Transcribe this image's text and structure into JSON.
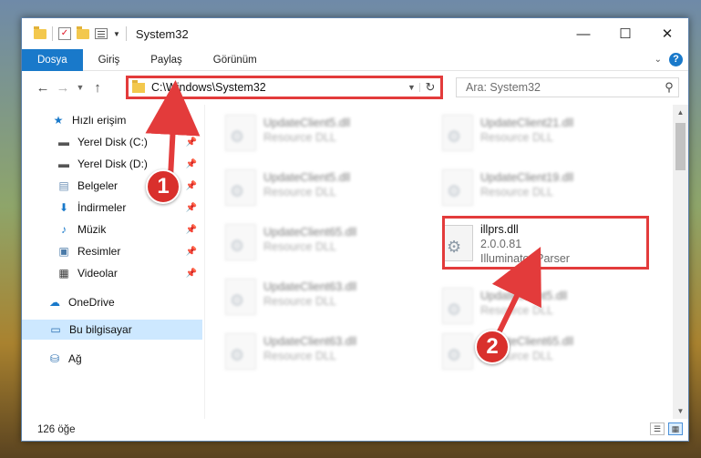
{
  "window": {
    "title": "System32",
    "controls": {
      "minimize": "—",
      "maximize": "☐",
      "close": "✕"
    }
  },
  "ribbon": {
    "tabs": [
      {
        "label": "Dosya",
        "active": true
      },
      {
        "label": "Giriş"
      },
      {
        "label": "Paylaş"
      },
      {
        "label": "Görünüm"
      }
    ],
    "expand_icon": "chevron-down-icon",
    "help_label": "?"
  },
  "address": {
    "path": "C:\\Windows\\System32",
    "search_placeholder": "Ara: System32"
  },
  "sidebar": {
    "items": [
      {
        "label": "Hızlı erişim",
        "icon": "star-icon"
      },
      {
        "label": "Yerel Disk (C:)",
        "icon": "drive-icon",
        "pinned": true
      },
      {
        "label": "Yerel Disk (D:)",
        "icon": "drive-icon",
        "pinned": true
      },
      {
        "label": "Belgeler",
        "icon": "documents-icon",
        "pinned": true
      },
      {
        "label": "İndirmeler",
        "icon": "download-icon",
        "pinned": true
      },
      {
        "label": "Müzik",
        "icon": "music-icon",
        "pinned": true
      },
      {
        "label": "Resimler",
        "icon": "pictures-icon",
        "pinned": true
      },
      {
        "label": "Videolar",
        "icon": "videos-icon",
        "pinned": true
      },
      {
        "label": "OneDrive",
        "icon": "cloud-icon"
      },
      {
        "label": "Bu bilgisayar",
        "icon": "computer-icon",
        "selected": true
      },
      {
        "label": "Ağ",
        "icon": "network-icon"
      }
    ]
  },
  "files": {
    "left": [
      {
        "name": "UpdateClient5.dll",
        "meta": "Resource DLL"
      },
      {
        "name": "UpdateClient5.dll",
        "meta": "Resource DLL"
      },
      {
        "name": "UpdateClient65.dll",
        "meta": "Resource DLL"
      },
      {
        "name": "UpdateClient63.dll",
        "meta": "Resource DLL"
      },
      {
        "name": "UpdateClient63.dll",
        "meta": "Resource DLL"
      }
    ],
    "right": [
      {
        "name": "UpdateClient21.dll",
        "meta": "Resource DLL"
      },
      {
        "name": "UpdateClient19.dll",
        "meta": "Resource DLL"
      },
      {
        "name": "UpdateClient5.dll",
        "meta": "Resource DLL"
      },
      {
        "name": "UpdateClient65.dll",
        "meta": "Resource DLL"
      }
    ],
    "highlighted": {
      "name": "illprs.dll",
      "version": "2.0.0.81",
      "description": "Illuminator Parser"
    }
  },
  "status": {
    "count": "126 öğe"
  },
  "callouts": [
    "1",
    "2"
  ],
  "colors": {
    "accent": "#1979ca",
    "highlight": "#e33b3b",
    "selection": "#cde8ff"
  }
}
